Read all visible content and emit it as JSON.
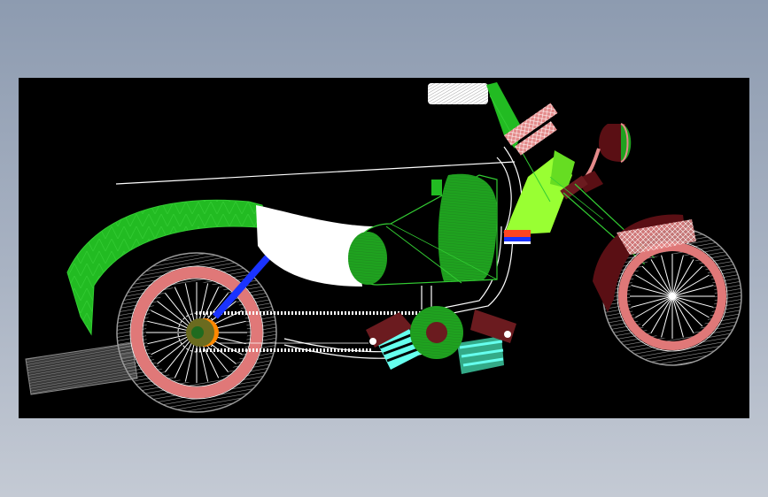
{
  "drawing": {
    "subject": "motorcycle-cad-drawing",
    "background_color": "#000000",
    "colors": {
      "fender_green": "#22bb22",
      "tank_green": "#1fa21f",
      "line_green": "#33cc33",
      "lime": "#99ff33",
      "seat_white": "#ffffff",
      "tire_gray": "#9a9a9a",
      "rim_pink": "#e07878",
      "spoke_white": "#ffffff",
      "crank_brown": "#6b1b1f",
      "cylinder_cyan": "#66ffee",
      "cylinder_teal": "#33aa88",
      "headlight_maroon": "#5a0f14",
      "salmon": "#e48a8a",
      "blue": "#1a33ff",
      "orange": "#ff8800",
      "olive": "#6b6b1f",
      "muffler_gray": "#8a8a8a",
      "grip_gray": "#cccccc"
    }
  }
}
